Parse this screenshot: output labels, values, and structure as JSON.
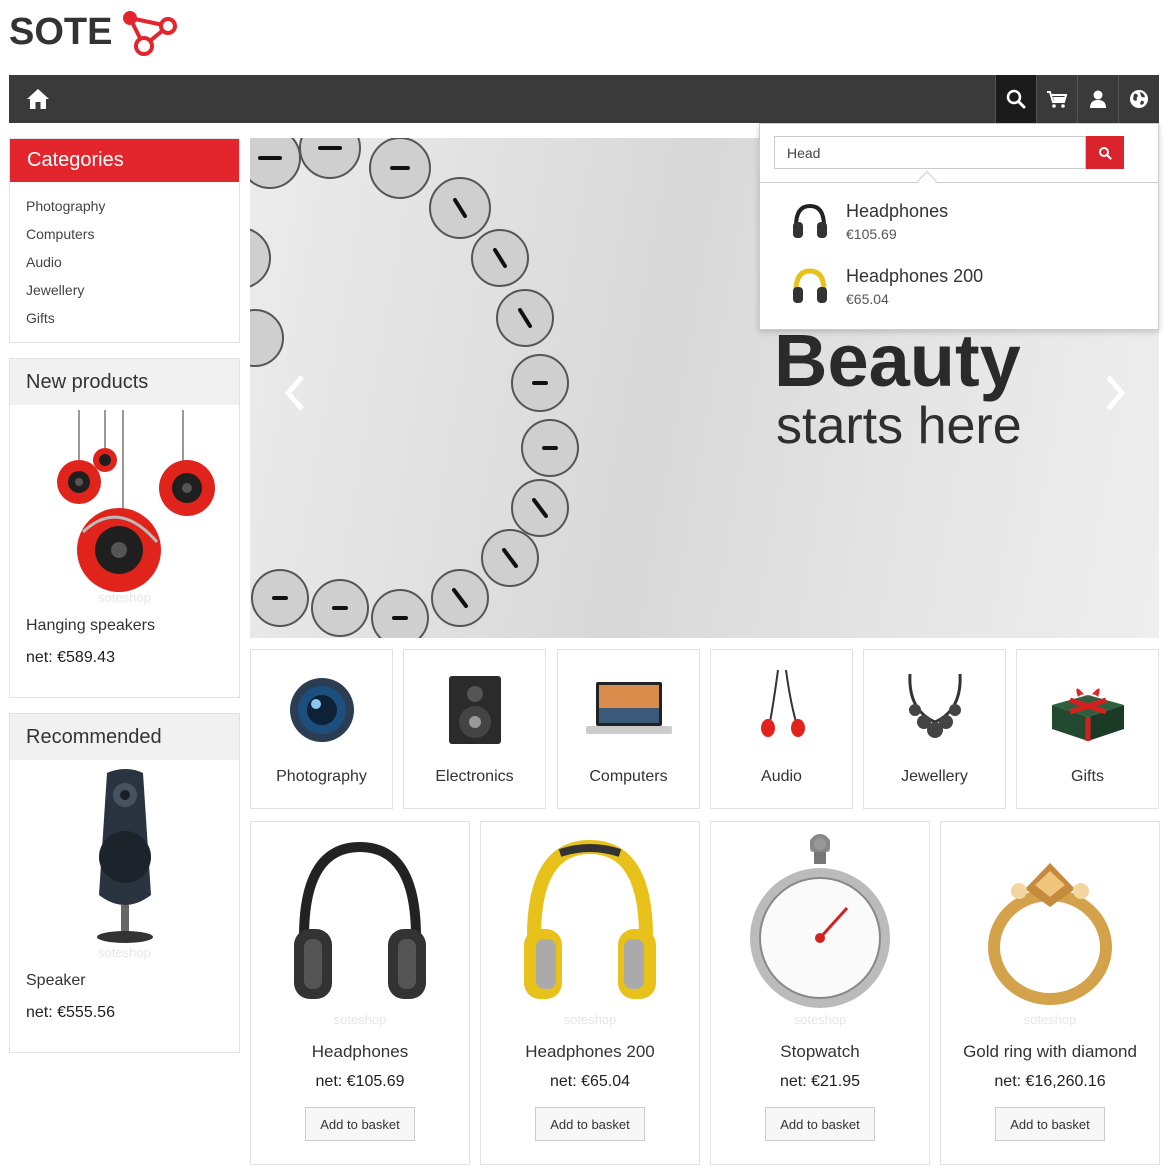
{
  "brand": {
    "logo_text": "SOTE",
    "accent": "#e3262e"
  },
  "navbar": {
    "home_icon": "home-icon",
    "buttons": [
      {
        "icon": "search-icon"
      },
      {
        "icon": "cart-icon"
      },
      {
        "icon": "user-icon"
      },
      {
        "icon": "globe-icon"
      }
    ]
  },
  "search": {
    "value": "Head",
    "results": [
      {
        "name": "Headphones",
        "price": "€105.69",
        "icon": "headphones-black-icon"
      },
      {
        "name": "Headphones 200",
        "price": "€65.04",
        "icon": "headphones-yellow-icon"
      }
    ]
  },
  "sidebar": {
    "categories": {
      "title": "Categories",
      "items": [
        "Photography",
        "Computers",
        "Audio",
        "Jewellery",
        "Gifts"
      ]
    },
    "new_products": {
      "title": "New products",
      "watermark": "soteshop",
      "name": "Hanging speakers",
      "price": "net: €589.43"
    },
    "recommended": {
      "title": "Recommended",
      "watermark": "soteshop",
      "name": "Speaker",
      "price": "net: €555.56"
    }
  },
  "hero": {
    "line1": "Beauty",
    "line2": "starts here"
  },
  "tiles": [
    {
      "label": "Photography",
      "icon": "camera-lens-icon"
    },
    {
      "label": "Electronics",
      "icon": "speaker-icon"
    },
    {
      "label": "Computers",
      "icon": "laptop-icon"
    },
    {
      "label": "Audio",
      "icon": "earphones-icon"
    },
    {
      "label": "Jewellery",
      "icon": "necklace-icon"
    },
    {
      "label": "Gifts",
      "icon": "gift-icon"
    }
  ],
  "products": [
    {
      "name": "Headphones",
      "price": "net: €105.69",
      "watermark": "soteshop",
      "button": "Add to basket"
    },
    {
      "name": "Headphones 200",
      "price": "net: €65.04",
      "watermark": "soteshop",
      "button": "Add to basket"
    },
    {
      "name": "Stopwatch",
      "price": "net: €21.95",
      "watermark": "soteshop",
      "button": "Add to basket"
    },
    {
      "name": "Gold ring with diamond",
      "price": "net: €16,260.16",
      "watermark": "soteshop",
      "button": "Add to basket"
    }
  ]
}
